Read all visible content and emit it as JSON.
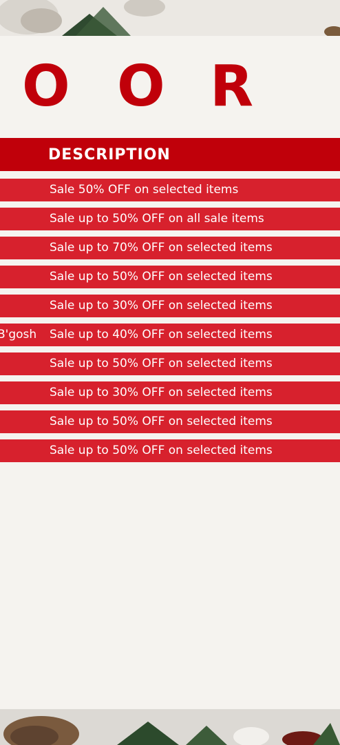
{
  "title_letters": [
    "O",
    "O",
    "R"
  ],
  "table": {
    "header": "DESCRIPTION",
    "rows": [
      {
        "brand": "",
        "description": "Sale 50% OFF on selected items"
      },
      {
        "brand": "",
        "description": "Sale up to 50% OFF on all sale items"
      },
      {
        "brand": "",
        "description": "Sale up to 70% OFF on selected items"
      },
      {
        "brand": "",
        "description": "Sale up to 50% OFF on selected items"
      },
      {
        "brand": "",
        "description": "Sale up to 30% OFF on selected items"
      },
      {
        "brand": "B'gosh",
        "description": "Sale up to 40% OFF on selected items"
      },
      {
        "brand": "",
        "description": "Sale up to 50% OFF on selected items"
      },
      {
        "brand": "",
        "description": "Sale up to 30% OFF on selected items"
      },
      {
        "brand": "",
        "description": "Sale up to 50% OFF on selected items"
      },
      {
        "brand": "",
        "description": "Sale up to 50% OFF on selected items"
      }
    ]
  },
  "colors": {
    "accent": "#c0000a",
    "row": "#d7212d",
    "panel": "#f5f3ef"
  }
}
